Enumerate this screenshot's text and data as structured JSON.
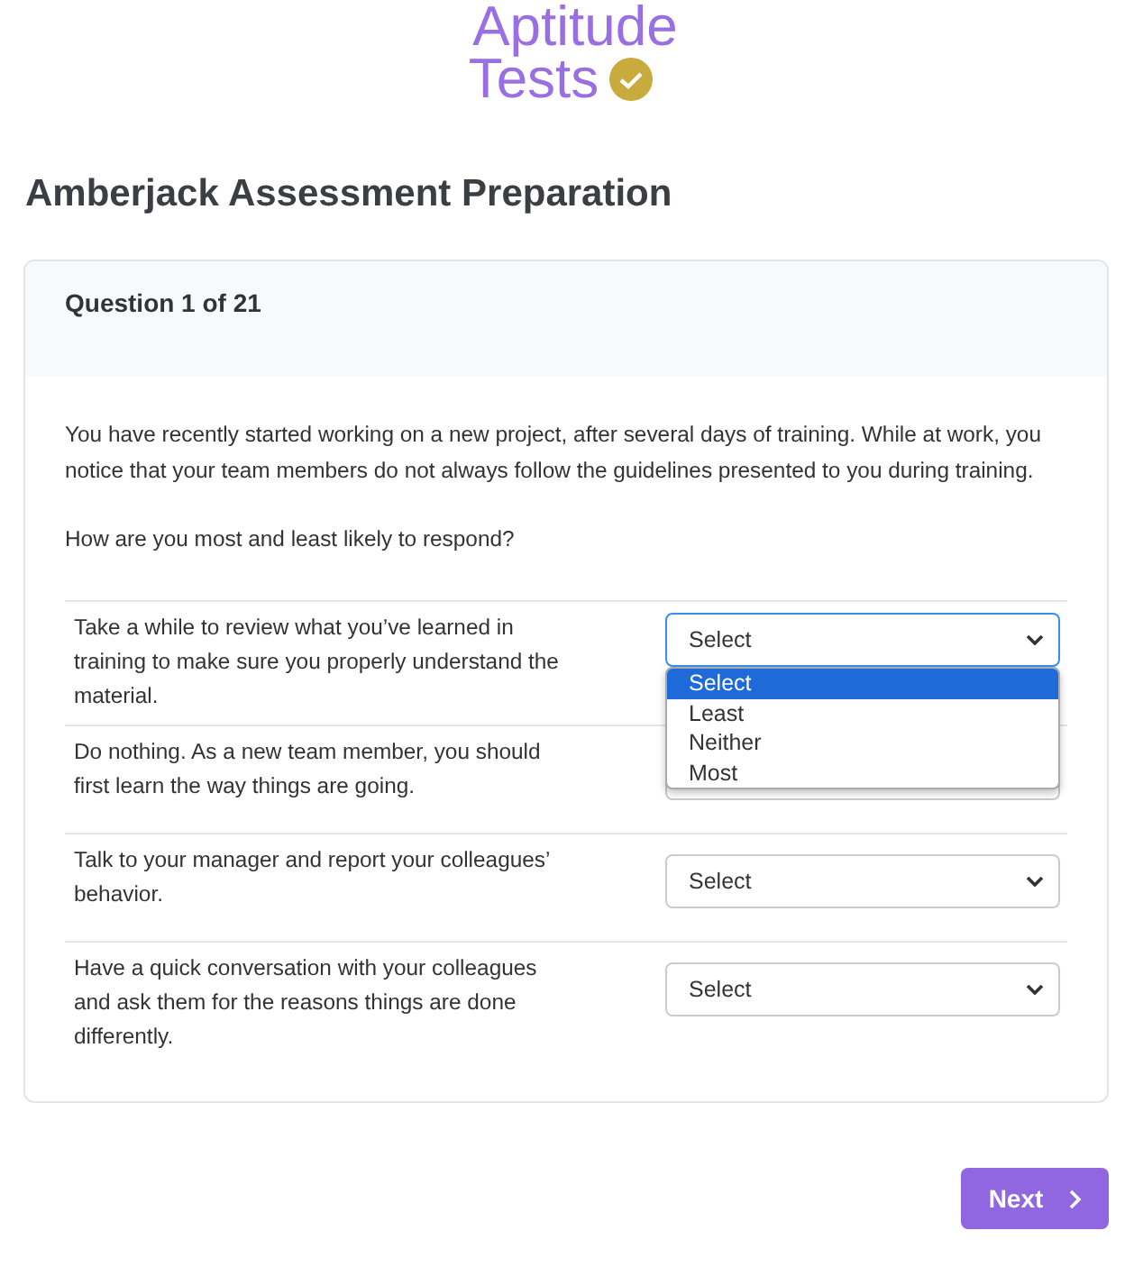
{
  "logo": {
    "line1": "Aptitude",
    "line2": "Tests"
  },
  "title": "Amberjack Assessment Preparation",
  "question": {
    "header": "Question 1 of 21",
    "paragraphs": [
      "You have recently started working on a new project, after several days of training. While at work, you notice that your team members do not always follow the guidelines presented to you during training.",
      "How are you most and least likely to respond?"
    ],
    "rows": [
      {
        "text": "Take a while to review what you’ve learned in training to make sure you properly understand the material.",
        "value": "Select",
        "focused": true,
        "options": [
          {
            "label": "Select",
            "selected": true
          },
          {
            "label": "Least",
            "selected": false
          },
          {
            "label": "Neither",
            "selected": false
          },
          {
            "label": "Most",
            "selected": false
          }
        ]
      },
      {
        "text": "Do nothing. As a new team member, you should first learn the way things are going.",
        "focused": false
      },
      {
        "text": "Talk to your manager and report your colleagues’ behavior.",
        "value": "Select",
        "focused": false
      },
      {
        "text": "Have a quick conversation with your colleagues and ask them for the reasons things are done differently.",
        "value": "Select",
        "focused": false
      }
    ]
  },
  "next_button": {
    "label": "Next"
  }
}
